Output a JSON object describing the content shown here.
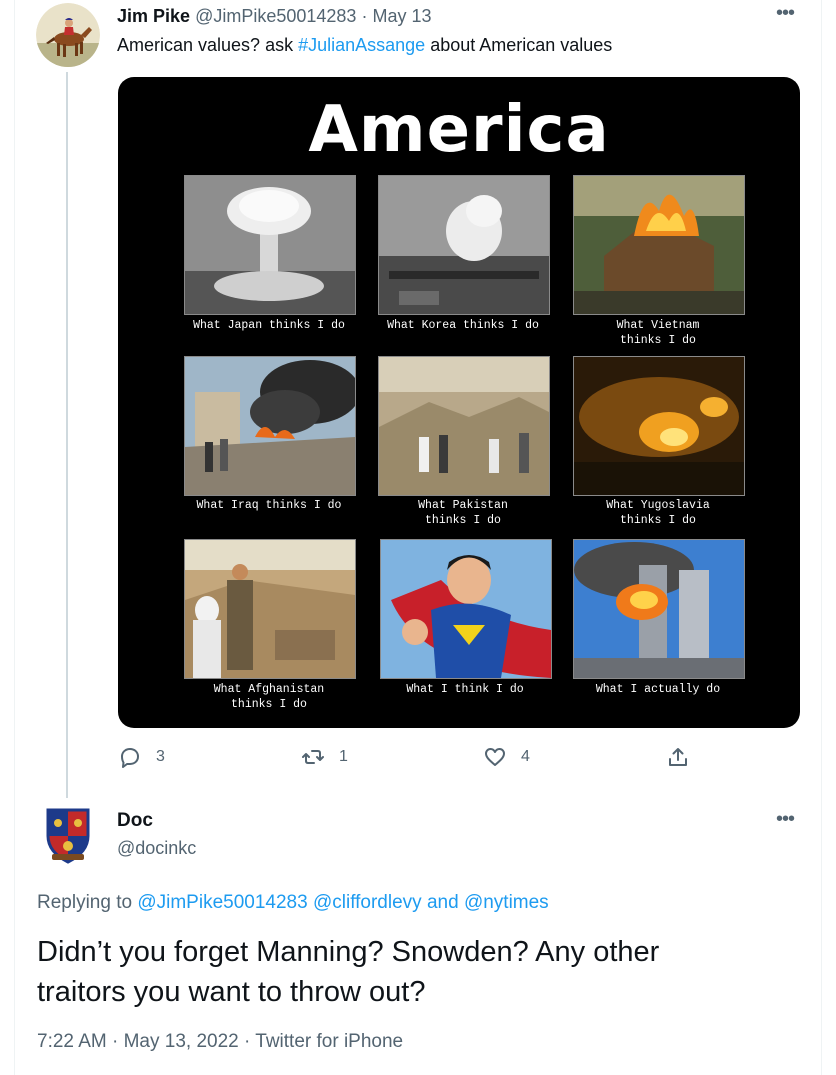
{
  "tweet": {
    "author_name": "Jim Pike",
    "author_handle": "@JimPike50014283",
    "date": "May 13",
    "text_before": "American values? ask ",
    "hashtag": "#JulianAssange",
    "text_after": " about American values",
    "image": {
      "title": "America",
      "panels": [
        {
          "caption_l1": "What Japan thinks I do",
          "caption_l2": "",
          "icon": "mushroom-cloud"
        },
        {
          "caption_l1": "What Korea thinks I do",
          "caption_l2": "",
          "icon": "bomb-explosion"
        },
        {
          "caption_l1": "What Vietnam",
          "caption_l2": "thinks I do",
          "icon": "burning-hut"
        },
        {
          "caption_l1": "What Iraq thinks I do",
          "caption_l2": "",
          "icon": "smoke-rubble"
        },
        {
          "caption_l1": "What Pakistan",
          "caption_l2": "thinks I do",
          "icon": "rubble-crowd"
        },
        {
          "caption_l1": "What Yugoslavia",
          "caption_l2": "thinks I do",
          "icon": "city-bombing-night"
        },
        {
          "caption_l1": "What Afghanistan",
          "caption_l2": "thinks I do",
          "icon": "rubble-people"
        },
        {
          "caption_l1": "What I think I do",
          "caption_l2": "",
          "icon": "superman"
        },
        {
          "caption_l1": "What I actually do",
          "caption_l2": "",
          "icon": "twin-towers-attack"
        }
      ]
    },
    "actions": {
      "reply_count": "3",
      "retweet_count": "1",
      "like_count": "4"
    }
  },
  "reply": {
    "author_name": "Doc",
    "author_handle": "@docinkc",
    "replying_prefix": "Replying to ",
    "replying_user1": "@JimPike50014283",
    "replying_user2": "@cliffordlevy",
    "replying_and": "and",
    "replying_user3": "@nytimes",
    "text_line1": "Didn’t you forget Manning? Snowden? Any other",
    "text_line2": "traitors you want to throw out?",
    "timestamp": "7:22 AM · May 13, 2022 · Twitter for iPhone"
  },
  "colors": {
    "accent": "#1d9bf0",
    "secondary_text": "#536471",
    "primary_text": "#0f1419"
  }
}
